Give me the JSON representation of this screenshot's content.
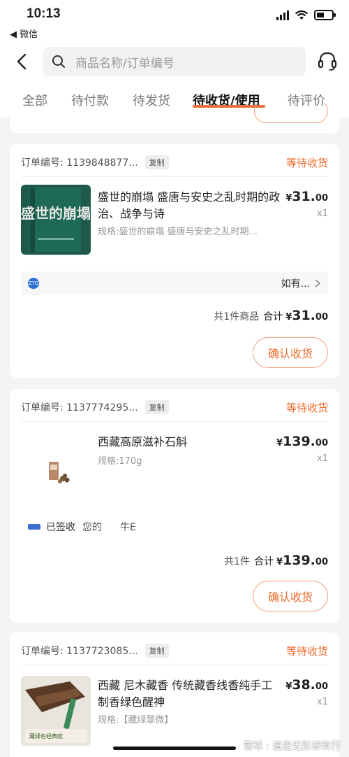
{
  "status_bar": {
    "time": "10:13",
    "back_app": "◀ 微信"
  },
  "nav": {
    "search_placeholder": "商品名称/订单编号"
  },
  "tabs": [
    {
      "label": "全部"
    },
    {
      "label": "待付款"
    },
    {
      "label": "待发货"
    },
    {
      "label": "待收货/使用"
    },
    {
      "label": "待评价"
    }
  ],
  "orders": [
    {
      "order_no": "订单编号: 1139848877...",
      "copy_label": "复制",
      "status": "等待收货",
      "title": "盛世的崩塌 盛唐与安史之乱时期的政治、战争与诗",
      "spec": "规格:盛世的崩塌 盛唐与安史之乱时期...",
      "price_cur": "¥",
      "price_int": "31.",
      "price_dec": "00",
      "qty": "x1",
      "logistics_text": "如有...",
      "logistics_logo": "ZTO",
      "summary_count": "共1件商品",
      "summary_total_label": "合计",
      "summary_cur": "¥",
      "summary_int": "31.",
      "summary_dec": "00",
      "confirm_label": "确认收货",
      "thumb_text": "盛世的崩塌"
    },
    {
      "order_no": "订单编号: 1137774295...",
      "copy_label": "复制",
      "status": "等待收货",
      "title": "西藏高原滋补石斛",
      "spec": "规格:170g",
      "price_cur": "¥",
      "price_int": "139.",
      "price_dec": "00",
      "qty": "x1",
      "logistics_status": "已签收",
      "logistics_text": "您的",
      "logistics_extra": "牛E",
      "summary_count": "共1件",
      "summary_total_label": "合计",
      "summary_cur": "¥",
      "summary_int": "139.",
      "summary_dec": "00",
      "confirm_label": "确认收货"
    },
    {
      "order_no": "订单编号: 1137723085...",
      "copy_label": "复制",
      "status": "等待收货",
      "title": "西藏 尼木藏香 传统藏香线香纯手工制香绿色醒神",
      "spec": "规格:【藏绿翠微】",
      "price_cur": "¥",
      "price_int": "38.",
      "price_dec": "00",
      "qty": "x1",
      "thumb_caption": "藏绿色经典款"
    }
  ],
  "watermark": "雪球 : 道是无形却有行",
  "colors": {
    "accent": "#f06a2a",
    "book_green": "#1d5a4a"
  }
}
